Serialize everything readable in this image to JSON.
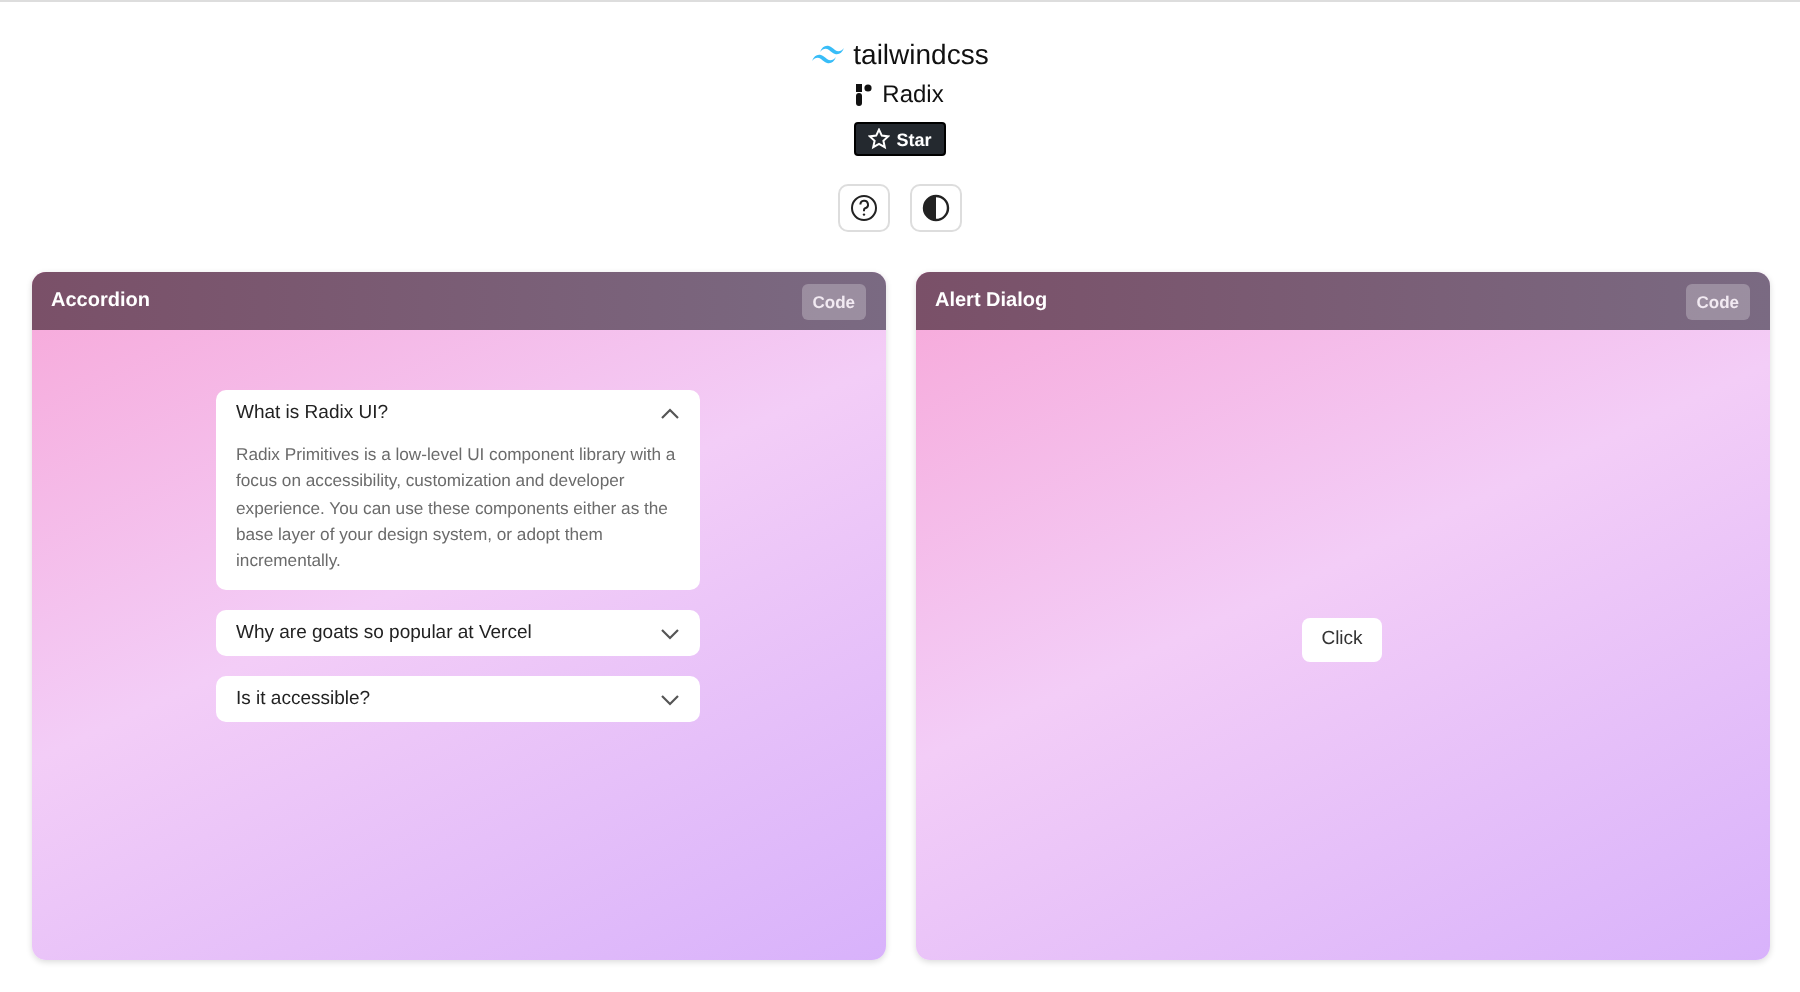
{
  "header": {
    "brand": "tailwindcss",
    "library": "Radix",
    "star_button": "Star"
  },
  "cards": [
    {
      "kind": "accordion",
      "title": "Accordion",
      "code_button": "Code",
      "items": [
        {
          "question": "What is Radix UI?",
          "expanded": true,
          "answer": "Radix Primitives is a low-level UI component library with a focus on accessibility, customization and developer experience. You can use these components either as the base layer of your design system, or adopt them incrementally."
        },
        {
          "question": "Why are goats so popular at Vercel",
          "expanded": false
        },
        {
          "question": "Is it accessible?",
          "expanded": false
        }
      ]
    },
    {
      "kind": "alert-dialog",
      "title": "Alert Dialog",
      "code_button": "Code",
      "trigger": "Click"
    }
  ]
}
